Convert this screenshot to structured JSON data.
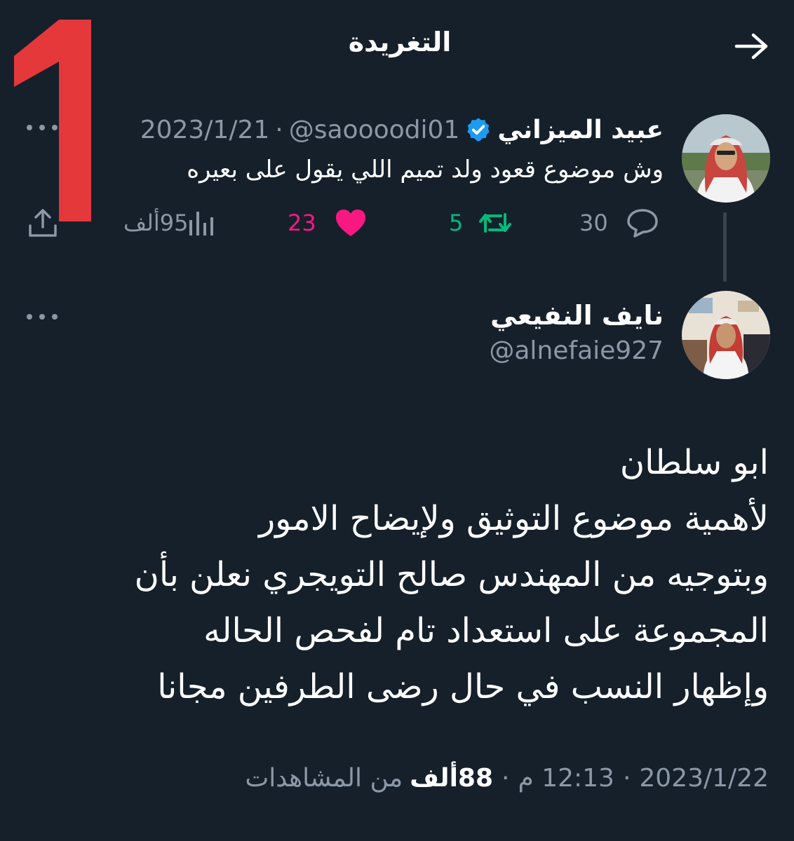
{
  "header": {
    "title": "التغريدة",
    "back_icon": "arrow-right-icon"
  },
  "overlay": {
    "number": "1",
    "color": "#e5383b"
  },
  "reply_to": {
    "name": "عبيد الميزاني",
    "verified": true,
    "handle": "@saoooodi01",
    "date": "2023/1/21",
    "separator": "·",
    "text": "وش موضوع قعود ولد تميم اللي يقول على بعيره",
    "actions": {
      "replies": "30",
      "retweets": "5",
      "likes": "23",
      "views": "95ألف"
    }
  },
  "tweet": {
    "name": "نايف النفيعي",
    "handle": "@alnefaie927",
    "body": [
      "ابو سلطان",
      "لأهمية موضوع التوثيق ولإيضاح الامور",
      "وبتوجيه من المهندس صالح التويجري نعلن بأن",
      "المجموعة على استعداد تام لفحص الحاله",
      "وإظهار النسب في حال رضى الطرفين مجانا"
    ],
    "date": "2023/1/22",
    "time": "12:13 م",
    "views_count": "88ألف",
    "views_label": "من المشاهدات",
    "separator": "·"
  },
  "colors": {
    "background": "#15202b",
    "muted": "#8b98a5",
    "retweet": "#00ba7c",
    "like": "#f91880",
    "verified": "#1d9bf0"
  }
}
